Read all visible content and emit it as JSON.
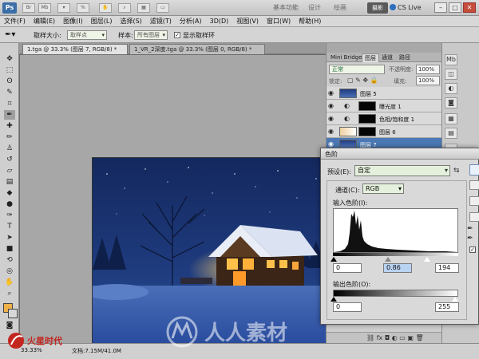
{
  "app": {
    "logo": "Ps",
    "workspace_tabs": [
      "基本功能",
      "设计",
      "绘画"
    ],
    "workspace_active": "摄影",
    "cs_live": "CS Live",
    "window_buttons": [
      "–",
      "□",
      "✕"
    ]
  },
  "menu": [
    "文件(F)",
    "编辑(E)",
    "图像(I)",
    "图层(L)",
    "选择(S)",
    "滤镜(T)",
    "分析(A)",
    "3D(D)",
    "视图(V)",
    "窗口(W)",
    "帮助(H)"
  ],
  "options": {
    "sample_size_label": "取样大小:",
    "sample_size_value": "取样点",
    "sample_label": "样本:",
    "sample_value": "所有图层",
    "show_ring_label": "显示取样环",
    "show_ring_checked": true
  },
  "doc_tabs": [
    {
      "label": "1.tga @ 33.3% (图层 7, RGB/8) *",
      "active": true
    },
    {
      "label": "1_VR_2深度.tga @ 33.3% (图层 0, RGB/8) *",
      "active": false
    }
  ],
  "status": {
    "zoom": "33.33%",
    "doc_size": "文档:7.15M/41.0M"
  },
  "layers_panel": {
    "tabs": [
      "Mini Bridge",
      "图层",
      "通道",
      "路径"
    ],
    "active_tab": "图层",
    "blend_mode": "正常",
    "opacity_label": "不透明度:",
    "opacity_value": "100%",
    "lock_label": "锁定:",
    "fill_label": "填充:",
    "fill_value": "100%",
    "layers": [
      {
        "name": "图层 5",
        "type": "pixel",
        "selected": false
      },
      {
        "name": "曝光度 1",
        "type": "adjustment",
        "selected": false
      },
      {
        "name": "色相/饱和度 1",
        "type": "adjustment",
        "selected": false
      },
      {
        "name": "图层 6",
        "type": "pixel",
        "selected": false
      },
      {
        "name": "图层 7",
        "type": "pixel",
        "selected": true
      }
    ]
  },
  "levels_dialog": {
    "title": "色阶",
    "preset_label": "预设(E):",
    "preset_value": "自定",
    "channel_label": "通道(C):",
    "channel_value": "RGB",
    "input_levels_label": "输入色阶(I):",
    "input_black": "0",
    "input_gamma": "0.86",
    "input_white": "194",
    "output_levels_label": "输出色阶(O):",
    "output_black": "0",
    "output_white": "255",
    "preview_checked": true
  },
  "watermark": {
    "text": "人人素材",
    "logo_text": "火星时代"
  },
  "colors": {
    "foreground": "#efb14a",
    "background": "#d7d7d7",
    "selection": "#4b78b4",
    "night_sky": "#1f3c7f"
  },
  "icons": {
    "tools": [
      "move",
      "marquee",
      "lasso",
      "quick-select",
      "crop",
      "eyedropper",
      "spot-heal",
      "brush",
      "clone-stamp",
      "history-brush",
      "eraser",
      "gradient",
      "blur",
      "dodge",
      "pen",
      "type",
      "path-select",
      "shape",
      "3d-rotate",
      "3d-orbit",
      "hand",
      "zoom"
    ],
    "dock": [
      "mini-bridge",
      "layers",
      "adjustments",
      "masks",
      "styles",
      "swatches",
      "navigator"
    ]
  }
}
